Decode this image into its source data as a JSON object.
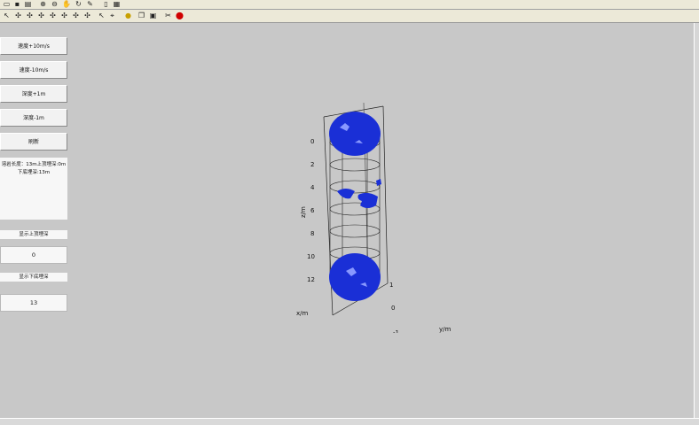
{
  "toolbar_row1": {
    "icons": [
      "folder-open-icon",
      "save-icon",
      "print-icon",
      "zoom-in-icon",
      "zoom-out-icon",
      "pan-hand-icon",
      "rotate-3d-icon",
      "data-cursor-icon",
      "page-icon",
      "grid-icon"
    ]
  },
  "toolbar_row2": {
    "icons": [
      "arrow-icon",
      "node-icon",
      "node-icon",
      "node-icon",
      "node-icon",
      "node-icon",
      "node-icon",
      "node-icon",
      "arrow-icon",
      "cursor-icon",
      "text-icon",
      "lightbulb-icon",
      "copy-icon",
      "window-icon",
      "scissors-icon",
      "stop-icon"
    ]
  },
  "sidebar": {
    "buttons": [
      "速度+10m/s",
      "速度-10m/s",
      "深度+1m",
      "深度-1m",
      "刷新"
    ],
    "info_line1": "溶岩长度：13m上顶埋深:0m",
    "info_line2": "下底埋深:13m",
    "top_label": "显示上顶埋深",
    "top_value": "0",
    "bottom_label": "显示下底埋深",
    "bottom_value": "13"
  },
  "plot": {
    "z_label": "z/m",
    "x_label": "x/m",
    "y_label": "y/m",
    "z_ticks": [
      "0",
      "2",
      "4",
      "6",
      "8",
      "10",
      "12"
    ],
    "y_ticks": [
      "1",
      "0",
      "-1"
    ],
    "fill_color": "#1a2fd6",
    "frame_color": "#222222"
  }
}
